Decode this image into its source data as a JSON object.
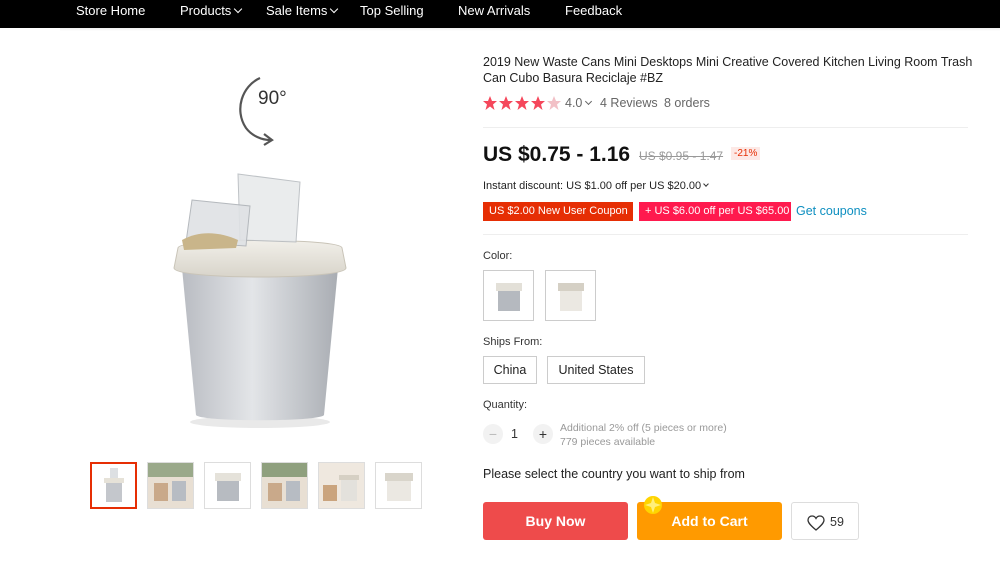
{
  "nav": {
    "items": [
      {
        "label": "Store Home",
        "caret": false
      },
      {
        "label": "Products",
        "caret": true
      },
      {
        "label": "Sale Items",
        "caret": true
      },
      {
        "label": "Top Selling",
        "caret": false
      },
      {
        "label": "New Arrivals",
        "caret": false
      },
      {
        "label": "Feedback",
        "caret": false
      }
    ]
  },
  "gallery": {
    "rotate_label": "90°",
    "thumbnail_count": 6,
    "active_thumbnail": 1
  },
  "product": {
    "title": "2019 New Waste Cans Mini Desktops Mini Creative Covered Kitchen Living Room Trash Can Cubo Basura Reciclaje #BZ",
    "rating_value": "4.0",
    "rating_fraction": 0.8,
    "reviews": "4 Reviews",
    "orders": "8 orders",
    "price": "US $0.75 - 1.16",
    "old_price": "US $0.95 - 1.47",
    "discount": "-21%",
    "instant_discount": "Instant discount: US $1.00 off per US $20.00",
    "coupon_1": "US $2.00 New User Coupon",
    "coupon_2": "+ US $6.00 off per US $65.00",
    "get_coupons": "Get coupons",
    "color_label": "Color:",
    "ships_from_label": "Ships From:",
    "ship_options": [
      "China",
      "United States"
    ],
    "quantity_label": "Quantity:",
    "quantity": "1",
    "qty_note_1": "Additional 2% off (5 pieces or more)",
    "qty_note_2": "779 pieces available",
    "ship_prompt": "Please select the country you want to ship from",
    "buy_now": "Buy Now",
    "add_to_cart": "Add to Cart",
    "wishlist_count": "59"
  },
  "colors": {
    "accent_red": "#e62e04",
    "buy_now": "#ee4b4b",
    "add_cart": "#ff9a00",
    "link": "#0e8fc0",
    "star": "#f5475b"
  }
}
